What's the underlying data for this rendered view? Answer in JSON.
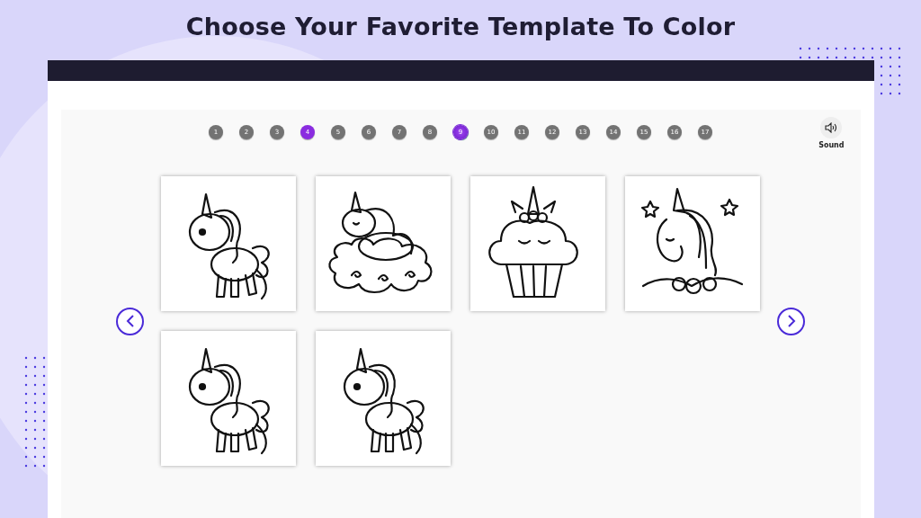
{
  "title": "Choose Your Favorite Template To Color",
  "pages": [
    {
      "label": "1",
      "selected": false,
      "visited": false
    },
    {
      "label": "2",
      "selected": false,
      "visited": false
    },
    {
      "label": "3",
      "selected": false,
      "visited": false
    },
    {
      "label": "4",
      "selected": false,
      "visited": true
    },
    {
      "label": "5",
      "selected": false,
      "visited": false
    },
    {
      "label": "6",
      "selected": false,
      "visited": false
    },
    {
      "label": "7",
      "selected": false,
      "visited": false
    },
    {
      "label": "8",
      "selected": false,
      "visited": false
    },
    {
      "label": "9",
      "selected": true,
      "visited": false
    },
    {
      "label": "10",
      "selected": false,
      "visited": false
    },
    {
      "label": "11",
      "selected": false,
      "visited": false
    },
    {
      "label": "12",
      "selected": false,
      "visited": false
    },
    {
      "label": "13",
      "selected": false,
      "visited": false
    },
    {
      "label": "14",
      "selected": false,
      "visited": false
    },
    {
      "label": "15",
      "selected": false,
      "visited": false
    },
    {
      "label": "16",
      "selected": false,
      "visited": false
    },
    {
      "label": "17",
      "selected": false,
      "visited": false
    }
  ],
  "sound": {
    "label": "Sound"
  },
  "templates": [
    {
      "kind": "unicorn"
    },
    {
      "kind": "unicorn-cloud"
    },
    {
      "kind": "cupcake"
    },
    {
      "kind": "unicorn-head"
    },
    {
      "kind": "unicorn"
    },
    {
      "kind": "unicorn"
    }
  ]
}
